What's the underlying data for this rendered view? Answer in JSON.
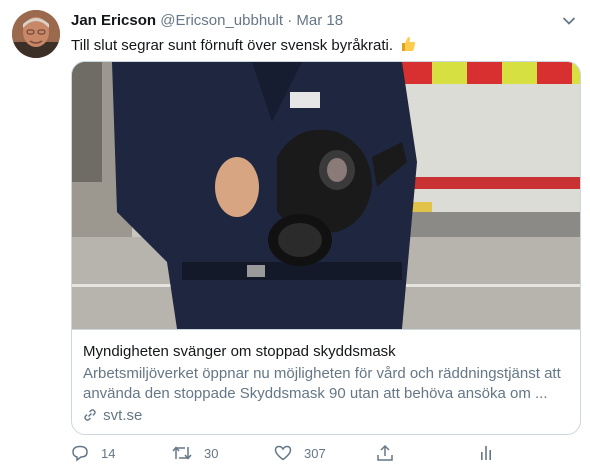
{
  "tweet": {
    "author_name": "Jan Ericson",
    "handle": "@Ericson_ubbhult",
    "separator": "·",
    "date": "Mar 18",
    "text": "Till slut segrar sunt förnuft över svensk byråkrati.",
    "emoji": "thumbs-up"
  },
  "card": {
    "title": "Myndigheten svänger om stoppad skyddsmask",
    "description_line1": "Arbetsmiljöverket öppnar nu möjligheten för vård och räddningstjänst att",
    "description_line2": "använda den stoppade Skyddsmask 90 utan att behöva ansöka om ...",
    "domain": "svt.se"
  },
  "actions": {
    "reply_count": "14",
    "retweet_count": "30",
    "like_count": "307"
  },
  "colors": {
    "text_primary": "#14171a",
    "text_secondary": "#657786",
    "border": "#ccd6dd"
  }
}
